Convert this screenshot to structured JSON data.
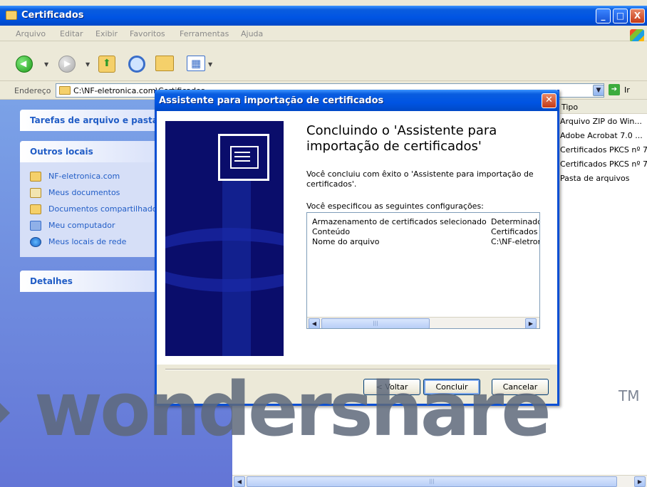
{
  "window": {
    "title": "Certificados",
    "controls": {
      "minimize": "_",
      "maximize": "□",
      "close": "X"
    }
  },
  "menu": [
    "Arquivo",
    "Editar",
    "Exibir",
    "Favoritos",
    "Ferramentas",
    "Ajuda"
  ],
  "toolbar": {
    "icons": [
      "back-icon",
      "forward-icon",
      "up-folder-icon",
      "search-icon",
      "folders-icon",
      "views-icon"
    ]
  },
  "address": {
    "label": "Endereço",
    "path": "C:\\NF-eletronica.com\\Certificados",
    "go_label": "Ir"
  },
  "left_pane": {
    "file_tasks": {
      "title": "Tarefas de arquivo e pasta"
    },
    "other_places": {
      "title": "Outros locais",
      "items": [
        {
          "label": "NF-eletronica.com",
          "icon": "folder-icon"
        },
        {
          "label": "Meus documentos",
          "icon": "documents-icon"
        },
        {
          "label": "Documentos compartilhados",
          "icon": "folder-icon"
        },
        {
          "label": "Meu computador",
          "icon": "computer-icon"
        },
        {
          "label": "Meus locais de rede",
          "icon": "network-icon"
        }
      ]
    },
    "details": {
      "title": "Detalhes"
    }
  },
  "file_list": {
    "column_header": "Tipo",
    "rows": [
      "Arquivo ZIP do Win...",
      "Adobe Acrobat 7.0 ...",
      "Certificados PKCS nº 7",
      "Certificados PKCS nº 7",
      "Pasta de arquivos"
    ]
  },
  "wizard": {
    "title": "Assistente para importação de certificados",
    "heading": "Concluindo o 'Assistente para importação de certificados'",
    "completed_text": "Você concluiu com êxito o 'Assistente para importação de certificados'.",
    "settings_label": "Você especificou as seguintes configurações:",
    "settings": [
      {
        "name": "Armazenamento de certificados selecionado",
        "value": "Determinado"
      },
      {
        "name": "Conteúdo",
        "value": "Certificados"
      },
      {
        "name": "Nome do arquivo",
        "value": "C:\\NF-eletronica"
      }
    ],
    "buttons": {
      "back": "< Voltar",
      "finish": "Concluir",
      "cancel": "Cancelar"
    }
  },
  "watermark": {
    "text": "wondershare",
    "tm": "TM"
  },
  "colors": {
    "title_bar": "#0054e3",
    "panel_link": "#215dc6",
    "wizard_art": "#0a0d6b",
    "watermark": "#5e687a"
  }
}
